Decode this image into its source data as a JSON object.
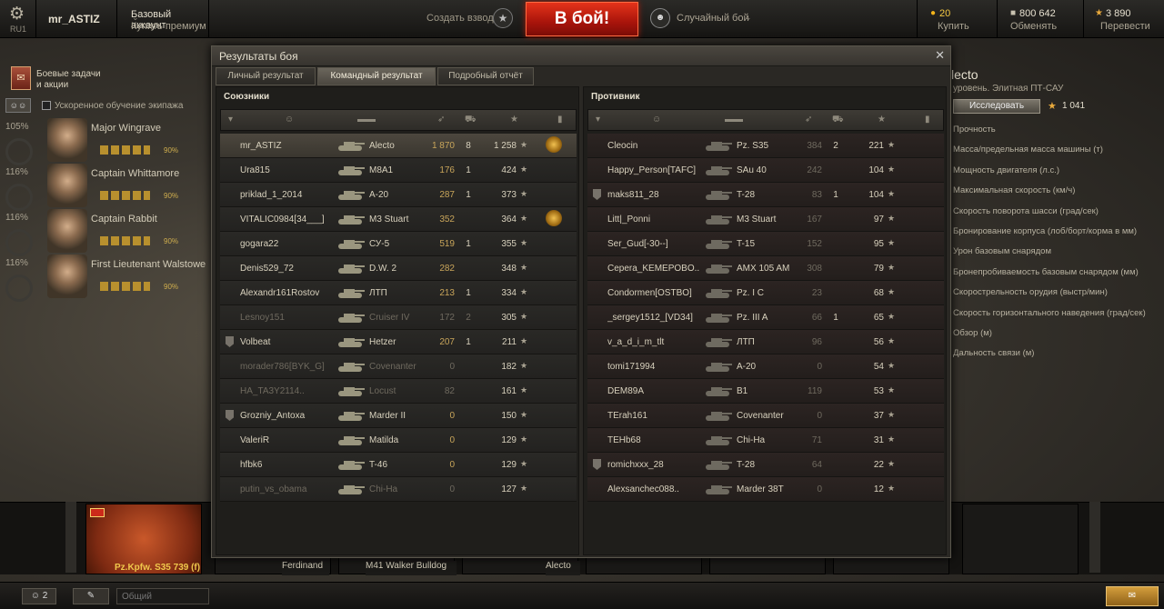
{
  "topbar": {
    "region": "RU1",
    "username": "mr_ASTIZ",
    "account_type": "Базовый аккаунт",
    "buy_premium": "Купить премиум",
    "create_platoon": "Создать взвод",
    "battle_button": "В бой!",
    "battle_mode": "Случайный бой",
    "gold": "20",
    "gold_action": "Купить",
    "credits": "800 642",
    "credits_action": "Обменять",
    "free_xp": "3 890",
    "free_xp_action": "Перевести"
  },
  "left": {
    "quests_line1": "Боевые задачи",
    "quests_line2": "и акции",
    "accelerated_crew": "Ускоренное обучение экипажа",
    "crew": [
      {
        "name": "Major Wingrave",
        "pct": "105%",
        "skill": "90%"
      },
      {
        "name": "Captain Whittamore",
        "pct": "116%",
        "skill": "90%"
      },
      {
        "name": "Captain Rabbit",
        "pct": "116%",
        "skill": "90%"
      },
      {
        "name": "First Lieutenant Walstowe",
        "pct": "116%",
        "skill": "90%"
      }
    ]
  },
  "right": {
    "vehicle_name": "lecto",
    "vehicle_class": "уровень. Элитная ПТ-САУ",
    "research": "Исследовать",
    "xp": "1 041",
    "specs": [
      "Прочность",
      "Масса/предельная масса машины (т)",
      "Мощность двигателя (л.с.)",
      "Максимальная скорость (км/ч)",
      "Скорость поворота шасси (град/сек)",
      "Бронирование корпуса (лоб/борт/корма в мм)",
      "Урон базовым снарядом",
      "Бронепробиваемость базовым снарядом (мм)",
      "Скорострельность орудия (выстр/мин)",
      "Скорость горизонтального наведения (град/сек)",
      "Обзор (м)",
      "Дальность связи (м)"
    ]
  },
  "window": {
    "title": "Результаты боя",
    "tabs": [
      "Личный результат",
      "Командный результат",
      "Подробный отчёт"
    ],
    "allies_title": "Союзники",
    "enemies_title": "Противник",
    "allies": [
      {
        "name": "mr_ASTIZ",
        "tank": "Alecto",
        "frags": "1 870",
        "kills": "8",
        "xp": "1 258",
        "platoon": false,
        "medal": true,
        "me": true,
        "dead": false
      },
      {
        "name": "Ura815",
        "tank": "M8A1",
        "frags": "176",
        "kills": "1",
        "xp": "424",
        "platoon": false,
        "medal": false,
        "me": false,
        "dead": false
      },
      {
        "name": "priklad_1_2014",
        "tank": "A-20",
        "frags": "287",
        "kills": "1",
        "xp": "373",
        "platoon": false,
        "medal": false,
        "me": false,
        "dead": false
      },
      {
        "name": "VITALIC0984[34___]",
        "tank": "M3 Stuart",
        "frags": "352",
        "kills": "",
        "xp": "364",
        "platoon": false,
        "medal": true,
        "me": false,
        "dead": false
      },
      {
        "name": "gogara22",
        "tank": "СУ-5",
        "frags": "519",
        "kills": "1",
        "xp": "355",
        "platoon": false,
        "medal": false,
        "me": false,
        "dead": false
      },
      {
        "name": "Denis529_72",
        "tank": "D.W. 2",
        "frags": "282",
        "kills": "",
        "xp": "348",
        "platoon": false,
        "medal": false,
        "me": false,
        "dead": false
      },
      {
        "name": "Alexandr161Rostov",
        "tank": "ЛТП",
        "frags": "213",
        "kills": "1",
        "xp": "334",
        "platoon": false,
        "medal": false,
        "me": false,
        "dead": false
      },
      {
        "name": "Lesnoy151",
        "tank": "Cruiser IV",
        "frags": "172",
        "kills": "2",
        "xp": "305",
        "platoon": false,
        "medal": false,
        "me": false,
        "dead": true
      },
      {
        "name": "Volbeat",
        "tank": "Hetzer",
        "frags": "207",
        "kills": "1",
        "xp": "211",
        "platoon": true,
        "medal": false,
        "me": false,
        "dead": false
      },
      {
        "name": "morader786[BYK_G]",
        "tank": "Covenanter",
        "frags": "0",
        "kills": "",
        "xp": "182",
        "platoon": false,
        "medal": false,
        "me": false,
        "dead": true
      },
      {
        "name": "HA_TA3Y2114..",
        "tank": "Locust",
        "frags": "82",
        "kills": "",
        "xp": "161",
        "platoon": false,
        "medal": false,
        "me": false,
        "dead": true
      },
      {
        "name": "Grozniy_Antoxa",
        "tank": "Marder II",
        "frags": "0",
        "kills": "",
        "xp": "150",
        "platoon": true,
        "medal": false,
        "me": false,
        "dead": false
      },
      {
        "name": "ValeriR",
        "tank": "Matilda",
        "frags": "0",
        "kills": "",
        "xp": "129",
        "platoon": false,
        "medal": false,
        "me": false,
        "dead": false
      },
      {
        "name": "hfbk6",
        "tank": "T-46",
        "frags": "0",
        "kills": "",
        "xp": "129",
        "platoon": false,
        "medal": false,
        "me": false,
        "dead": false
      },
      {
        "name": "putin_vs_obama",
        "tank": "Chi-Ha",
        "frags": "0",
        "kills": "",
        "xp": "127",
        "platoon": false,
        "medal": false,
        "me": false,
        "dead": true
      }
    ],
    "enemies": [
      {
        "name": "Cleocin",
        "tank": "Pz. S35",
        "frags": "384",
        "kills": "2",
        "xp": "221",
        "platoon": false
      },
      {
        "name": "Happy_Person[TAFC]",
        "tank": "SAu 40",
        "frags": "242",
        "kills": "",
        "xp": "104",
        "platoon": false
      },
      {
        "name": "maks811_28",
        "tank": "T-28",
        "frags": "83",
        "kills": "1",
        "xp": "104",
        "platoon": true
      },
      {
        "name": "Litt|_Ponni",
        "tank": "M3 Stuart",
        "frags": "167",
        "kills": "",
        "xp": "97",
        "platoon": false
      },
      {
        "name": "Ser_Gud[-30--]",
        "tank": "T-15",
        "frags": "152",
        "kills": "",
        "xp": "95",
        "platoon": false
      },
      {
        "name": "Cepera_KEMEPOBO..",
        "tank": "AMX 105 AM",
        "frags": "308",
        "kills": "",
        "xp": "79",
        "platoon": false
      },
      {
        "name": "Condormen[OSTBO]",
        "tank": "Pz. I C",
        "frags": "23",
        "kills": "",
        "xp": "68",
        "platoon": false
      },
      {
        "name": "_sergey1512_[VD34]",
        "tank": "Pz. III A",
        "frags": "66",
        "kills": "1",
        "xp": "65",
        "platoon": false
      },
      {
        "name": "v_a_d_i_m_tlt",
        "tank": "ЛТП",
        "frags": "96",
        "kills": "",
        "xp": "56",
        "platoon": false
      },
      {
        "name": "tomi171994",
        "tank": "A-20",
        "frags": "0",
        "kills": "",
        "xp": "54",
        "platoon": false
      },
      {
        "name": "DEM89A",
        "tank": "B1",
        "frags": "119",
        "kills": "",
        "xp": "53",
        "platoon": false
      },
      {
        "name": "TErah161",
        "tank": "Covenanter",
        "frags": "0",
        "kills": "",
        "xp": "37",
        "platoon": false
      },
      {
        "name": "TEHb68",
        "tank": "Chi-Ha",
        "frags": "71",
        "kills": "",
        "xp": "31",
        "platoon": false
      },
      {
        "name": "romichxxx_28",
        "tank": "T-28",
        "frags": "64",
        "kills": "",
        "xp": "22",
        "platoon": true
      },
      {
        "name": "Alexsanchec088..",
        "tank": "Marder 38T",
        "frags": "0",
        "kills": "",
        "xp": "12",
        "platoon": false
      }
    ]
  },
  "carousel": {
    "selected_tank": "Pz.Kpfw. S35 739 (f)",
    "labels": [
      "Ferdinand",
      "M41 Walker Bulldog",
      "Alecto"
    ]
  },
  "bottombar": {
    "friends_count": "2",
    "chat_placeholder": "Общий"
  }
}
